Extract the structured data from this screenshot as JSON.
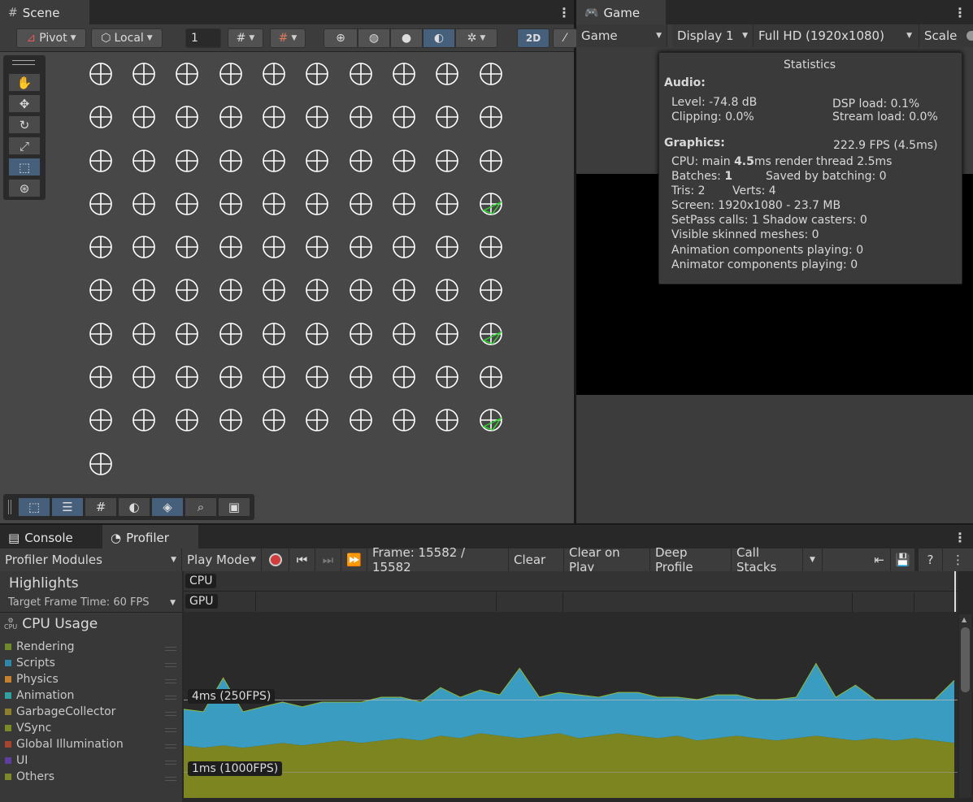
{
  "scene_window": {
    "tab_title": "Scene",
    "pivot_label": "Pivot",
    "space_label": "Local",
    "grid_size": "1",
    "mode_2d": "2D",
    "icon_names": [
      "hash-icon",
      "pivot-icon",
      "local-icon",
      "grid-snap-icon",
      "increment-snap-icon",
      "gizmo-globe-icon",
      "wireframe-icon",
      "shaded-icon",
      "shading-mode-icon",
      "debug-icon",
      "2d-icon",
      "audio-mute-icon"
    ]
  },
  "tools": {
    "items": [
      "hand-tool",
      "move-tool",
      "rotate-tool",
      "scale-tool",
      "rect-tool",
      "transform-tool"
    ],
    "selected": "rect-tool"
  },
  "overlays": {
    "items": [
      "rect-overlay",
      "scene-properties-overlay",
      "grid-overlay",
      "shading-overlay",
      "layer-overlay",
      "search-overlay",
      "camera-overlay"
    ]
  },
  "game_window": {
    "tab_title": "Game",
    "mode": "Game",
    "display": "Display 1",
    "resolution": "Full HD (1920x1080)",
    "scale_label": "Scale"
  },
  "statistics": {
    "title": "Statistics",
    "audio_heading": "Audio:",
    "level": "Level: -74.8 dB",
    "dsp_load": "DSP load: 0.1%",
    "clipping": "Clipping: 0.0%",
    "stream_load": "Stream load: 0.0%",
    "graphics_heading": "Graphics:",
    "fps": "222.9 FPS (4.5ms)",
    "cpu_prefix": "CPU: main ",
    "cpu_main": "4.5",
    "cpu_suffix": "ms  render thread 2.5ms",
    "batches_prefix": "Batches: ",
    "batches_value": "1",
    "saved_batching": "Saved by batching: 0",
    "tris": "Tris: 2",
    "verts": "Verts: 4",
    "screen": "Screen: 1920x1080 - 23.7 MB",
    "setpass": "SetPass calls: 1  Shadow casters: 0",
    "skinned": "Visible skinned meshes: 0",
    "animation_components": "Animation components playing: 0",
    "animator_components": "Animator components playing: 0"
  },
  "bottom_tabs": {
    "console": "Console",
    "profiler": "Profiler"
  },
  "profiler": {
    "modules": "Profiler Modules",
    "play_mode": "Play Mode",
    "frame": "Frame: 15582 / 15582",
    "clear": "Clear",
    "clear_on_play": "Clear on Play",
    "deep_profile": "Deep Profile",
    "call_stacks": "Call Stacks",
    "highlights": "Highlights",
    "target_frame_time": "Target Frame Time: 60 FPS",
    "cpu_lane": "CPU",
    "gpu_lane": "GPU",
    "cpu_usage": "CPU Usage",
    "cpu_badge": "CPU",
    "legend": [
      {
        "name": "Rendering",
        "color": "#6f8a2a"
      },
      {
        "name": "Scripts",
        "color": "#2f86a8"
      },
      {
        "name": "Physics",
        "color": "#c4802c"
      },
      {
        "name": "Animation",
        "color": "#2fa0a0"
      },
      {
        "name": "GarbageCollector",
        "color": "#8e7f2d"
      },
      {
        "name": "VSync",
        "color": "#7b8a23"
      },
      {
        "name": "Global Illumination",
        "color": "#a8432f"
      },
      {
        "name": "UI",
        "color": "#5c3fa0"
      },
      {
        "name": "Others",
        "color": "#7d8a26"
      }
    ],
    "line_4ms": "4ms (250FPS)",
    "line_1ms": "1ms (1000FPS)"
  },
  "chart_data": {
    "type": "area",
    "title": "CPU Usage",
    "series": [
      {
        "name": "VSync",
        "color": "#7d8520",
        "values": [
          2.1,
          2.0,
          2.1,
          2.0,
          2.1,
          2.2,
          2.1,
          2.2,
          2.3,
          2.2,
          2.3,
          2.4,
          2.3,
          2.5,
          2.4,
          2.6,
          2.5,
          2.4,
          2.5,
          2.6,
          2.4,
          2.5,
          2.6,
          2.5,
          2.4,
          2.5,
          2.3,
          2.4,
          2.5,
          2.4,
          2.3,
          2.4,
          2.5,
          2.4,
          2.3,
          2.4,
          2.3,
          2.4,
          2.3,
          2.2
        ]
      },
      {
        "name": "Scripts",
        "color": "#3a9cc0",
        "values": [
          1.5,
          1.5,
          2.8,
          1.5,
          1.6,
          1.7,
          1.6,
          1.7,
          1.6,
          1.7,
          1.8,
          1.7,
          1.6,
          2.0,
          1.7,
          1.8,
          1.7,
          2.9,
          1.6,
          1.7,
          1.8,
          1.6,
          1.7,
          1.8,
          1.7,
          1.6,
          1.7,
          1.8,
          1.7,
          1.6,
          1.7,
          1.7,
          3.0,
          1.7,
          2.3,
          1.6,
          1.7,
          1.6,
          1.7,
          2.6
        ]
      }
    ],
    "reference_lines": [
      "4ms (250FPS)",
      "1ms (1000FPS)"
    ]
  }
}
